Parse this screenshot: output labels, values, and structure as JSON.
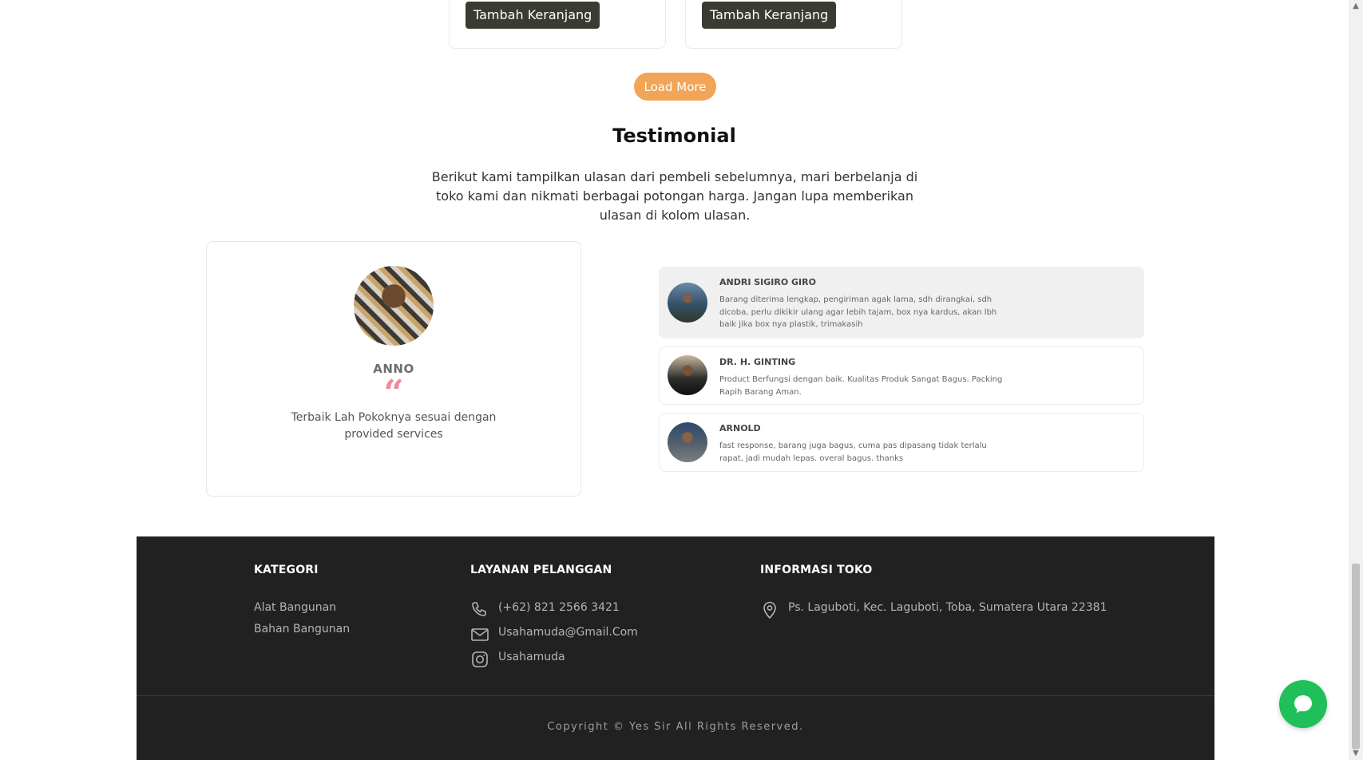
{
  "products": {
    "cart_label_1": "Tambah Keranjang",
    "cart_label_2": "Tambah Keranjang",
    "load_more": "Load More"
  },
  "testimonial": {
    "title": "Testimonial",
    "description": "Berikut kami tampilkan ulasan dari pembeli sebelumnya, mari berbelanja di toko kami dan nikmati berbagai potongan harga. Jangan lupa memberikan ulasan di kolom ulasan.",
    "featured": {
      "name": "ANNO",
      "quote_mark": "“",
      "text": "Terbaik Lah Pokoknya sesuai dengan provided services"
    },
    "reviews": [
      {
        "name": "ANDRI SIGIRO GIRO",
        "text": "Barang diterima lengkap, pengiriman agak lama, sdh dirangkai, sdh dicoba, perlu dikikir ulang agar lebih tajam, box nya kardus, akan lbh baik jika box nya plastik, trimakasih"
      },
      {
        "name": "DR. H. GINTING",
        "text": "Product Berfungsi dengan baik. Kualitas Produk Sangat Bagus. Packing Rapih Barang Aman."
      },
      {
        "name": "ARNOLD",
        "text": "fast response, barang juga bagus, cuma pas dipasang tidak terlalu rapat, jadi mudah lepas. overal bagus. thanks"
      }
    ]
  },
  "footer": {
    "kategori": {
      "heading": "KATEGORI",
      "items": [
        "Alat Bangunan",
        "Bahan Bangunan"
      ]
    },
    "layanan": {
      "heading": "LAYANAN PELANGGAN",
      "phone": "(+62) 821 2566 3421",
      "email": "Usahamuda@Gmail.Com",
      "instagram": "Usahamuda"
    },
    "informasi": {
      "heading": "INFORMASI TOKO",
      "address": "Ps. Laguboti, Kec. Laguboti, Toba, Sumatera Utara 22381"
    },
    "copyright": "Copyright © Yes Sir All Rights Reserved."
  },
  "icons": {
    "phone": "phone-icon",
    "email": "mail-icon",
    "instagram": "instagram-icon",
    "location": "map-pin-icon",
    "chat": "chat-icon"
  },
  "colors": {
    "accent": "#f2a457",
    "button_dark": "#3b3b33",
    "footer_bg": "#212121",
    "quote": "#f08a9b",
    "chat": "#1fbf5a"
  }
}
